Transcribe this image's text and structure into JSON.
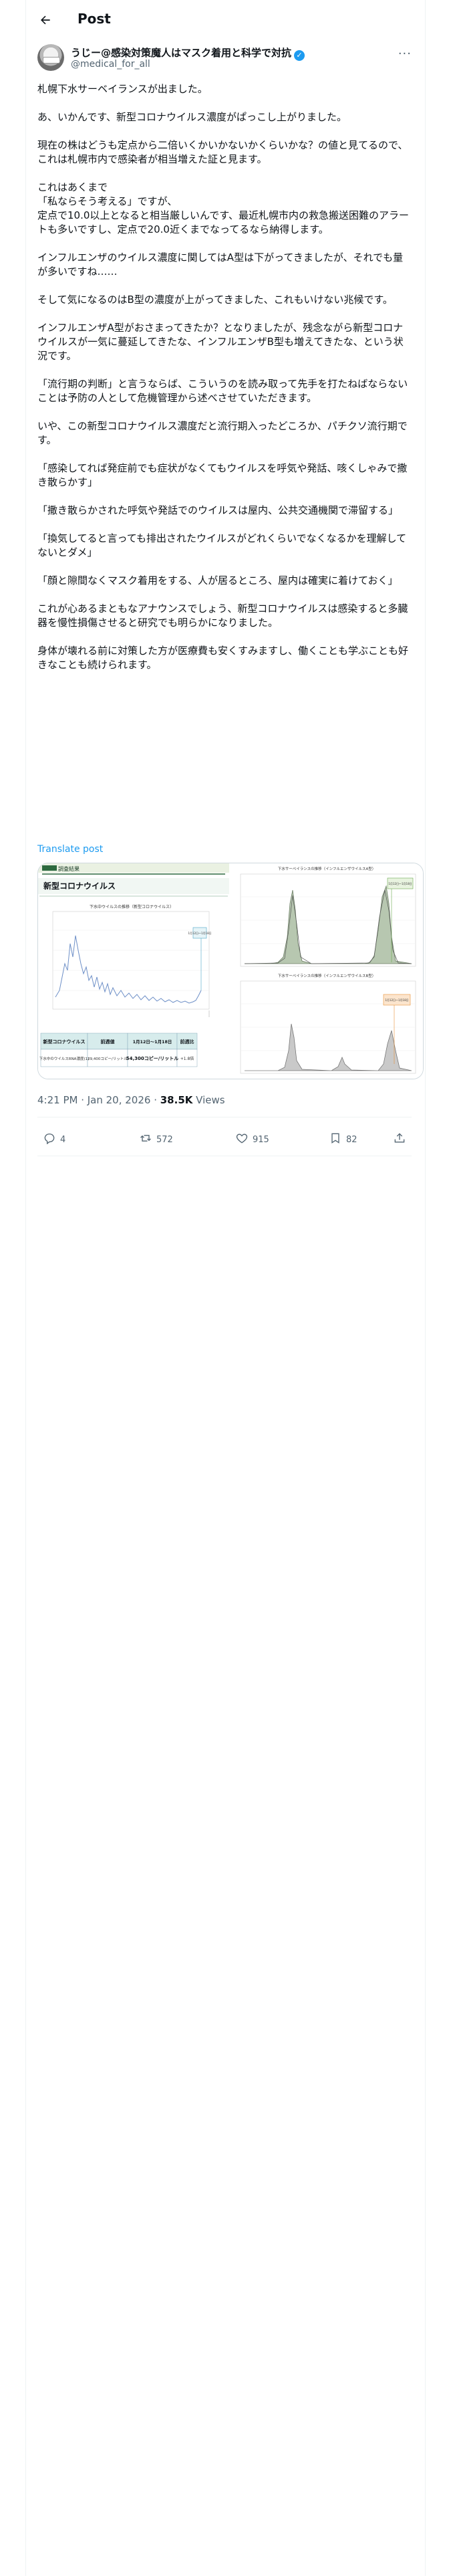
{
  "header": {
    "title": "Post"
  },
  "author": {
    "name": "うじー@感染対策魔人はマスク着用と科学で対抗",
    "handle": "@medical_for_all"
  },
  "post": {
    "paragraphs": [
      "札幌下水サーベイランスが出ました。",
      "あ、いかんです、新型コロナウイルス濃度がぱっこし上がりました。",
      "現在の株はどうも定点から二倍いくかいかないかくらいかな？の値と見てるので、これは札幌市内で感染者が相当増えた証と見ます。",
      "これはあくまで\n「私ならそう考える」ですが、\n定点で10.0以上となると相当厳しいんです、最近札幌市内の救急搬送困難のアラートも多いですし、定点で20.0近くまでなってるなら納得します。",
      "インフルエンザのウイルス濃度に関してはA型は下がってきましたが、それでも量が多いですね……",
      "そして気になるのはB型の濃度が上がってきました、これもいけない兆候です。",
      "インフルエンザA型がおさまってきたか？となりましたが、残念ながら新型コロナウイルスが一気に蔓延してきたな、インフルエンザB型も増えてきたな、という状況です。",
      "「流行期の判断」と言うならば、こういうのを読み取って先手を打たねばならないことは予防の人として危機管理から述べさせていただきます。",
      "いや、この新型コロナウイルス濃度だと流行期入ったどころか、パチクソ流行期です。",
      "「感染してれば発症前でも症状がなくてもウイルスを呼気や発話、咳くしゃみで撒き散らかす」",
      "「撒き散らかされた呼気や発話でのウイルスは屋内、公共交通機関で滞留する」",
      "「換気してると言っても排出されたウイルスがどれくらいでなくなるかを理解してないとダメ」",
      "「顔と隙間なくマスク着用をする、人が居るところ、屋内は確実に着けておく」",
      "これが心あるまともなアナウンスでしょう、新型コロナウイルスは感染すると多臓器を慢性損傷させると研究でも明らかになりました。",
      "身体が壊れる前に対策した方が医療費も安くすみますし、働くことも学ぶことも好きなことも続けられます。"
    ],
    "translate_label": "Translate post"
  },
  "media": {
    "left": {
      "banner": "調査結果",
      "heading": "新型コロナウイルス",
      "chart_title": "下水中ウイルスの推移（新型コロナウイルス）",
      "legend_label": "1月12日〜1月18日",
      "table_headers": [
        "新型コロナウイルス",
        "前週値",
        "1月12日〜1月18日",
        "前週比"
      ],
      "table_row": [
        "下水中のウイルスRNA濃度(1)",
        "29,400コピー/リットル",
        "54,300コピー/リットル",
        "+1.8倍"
      ]
    },
    "right_top": {
      "chart_title": "下水サーベイランスの推移（インフルエンザウイルスA型）",
      "legend_label": "1月12日〜1月18日",
      "color": "#6aa84f"
    },
    "right_bottom": {
      "chart_title": "下水サーベイランスの推移（インフルエンザウイルスB型）",
      "legend_label": "1月12日〜1月18日",
      "color": "#e69138"
    }
  },
  "meta": {
    "time": "4:21 PM · Jan 20, 2026 · ",
    "views_count": "38.5K",
    "views_label": " Views"
  },
  "actions": {
    "replies": "4",
    "reposts": "572",
    "likes": "915",
    "bookmarks": "82"
  },
  "colors": {
    "accent": "#1d9bf0",
    "muted": "#536471",
    "border": "#eff3f4"
  }
}
